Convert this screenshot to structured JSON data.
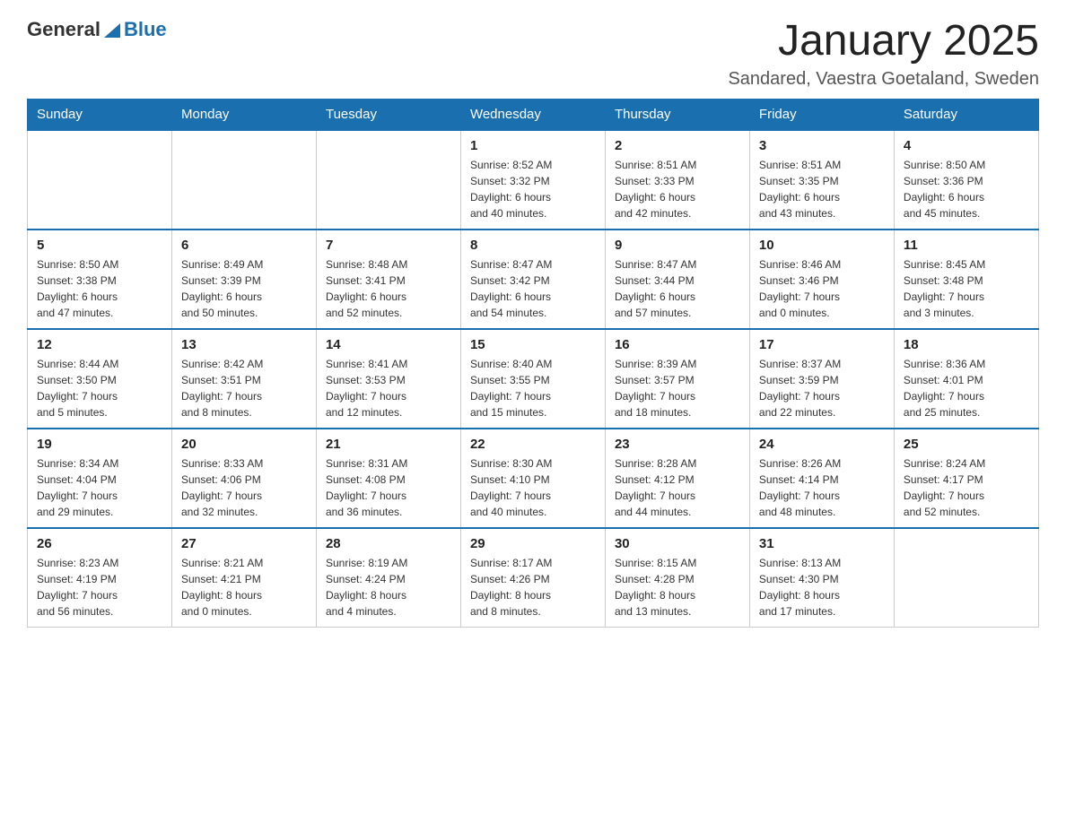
{
  "header": {
    "logo": {
      "general": "General",
      "blue": "Blue"
    },
    "title": "January 2025",
    "subtitle": "Sandared, Vaestra Goetaland, Sweden"
  },
  "weekdays": [
    "Sunday",
    "Monday",
    "Tuesday",
    "Wednesday",
    "Thursday",
    "Friday",
    "Saturday"
  ],
  "weeks": [
    [
      {
        "day": "",
        "info": ""
      },
      {
        "day": "",
        "info": ""
      },
      {
        "day": "",
        "info": ""
      },
      {
        "day": "1",
        "info": "Sunrise: 8:52 AM\nSunset: 3:32 PM\nDaylight: 6 hours\nand 40 minutes."
      },
      {
        "day": "2",
        "info": "Sunrise: 8:51 AM\nSunset: 3:33 PM\nDaylight: 6 hours\nand 42 minutes."
      },
      {
        "day": "3",
        "info": "Sunrise: 8:51 AM\nSunset: 3:35 PM\nDaylight: 6 hours\nand 43 minutes."
      },
      {
        "day": "4",
        "info": "Sunrise: 8:50 AM\nSunset: 3:36 PM\nDaylight: 6 hours\nand 45 minutes."
      }
    ],
    [
      {
        "day": "5",
        "info": "Sunrise: 8:50 AM\nSunset: 3:38 PM\nDaylight: 6 hours\nand 47 minutes."
      },
      {
        "day": "6",
        "info": "Sunrise: 8:49 AM\nSunset: 3:39 PM\nDaylight: 6 hours\nand 50 minutes."
      },
      {
        "day": "7",
        "info": "Sunrise: 8:48 AM\nSunset: 3:41 PM\nDaylight: 6 hours\nand 52 minutes."
      },
      {
        "day": "8",
        "info": "Sunrise: 8:47 AM\nSunset: 3:42 PM\nDaylight: 6 hours\nand 54 minutes."
      },
      {
        "day": "9",
        "info": "Sunrise: 8:47 AM\nSunset: 3:44 PM\nDaylight: 6 hours\nand 57 minutes."
      },
      {
        "day": "10",
        "info": "Sunrise: 8:46 AM\nSunset: 3:46 PM\nDaylight: 7 hours\nand 0 minutes."
      },
      {
        "day": "11",
        "info": "Sunrise: 8:45 AM\nSunset: 3:48 PM\nDaylight: 7 hours\nand 3 minutes."
      }
    ],
    [
      {
        "day": "12",
        "info": "Sunrise: 8:44 AM\nSunset: 3:50 PM\nDaylight: 7 hours\nand 5 minutes."
      },
      {
        "day": "13",
        "info": "Sunrise: 8:42 AM\nSunset: 3:51 PM\nDaylight: 7 hours\nand 8 minutes."
      },
      {
        "day": "14",
        "info": "Sunrise: 8:41 AM\nSunset: 3:53 PM\nDaylight: 7 hours\nand 12 minutes."
      },
      {
        "day": "15",
        "info": "Sunrise: 8:40 AM\nSunset: 3:55 PM\nDaylight: 7 hours\nand 15 minutes."
      },
      {
        "day": "16",
        "info": "Sunrise: 8:39 AM\nSunset: 3:57 PM\nDaylight: 7 hours\nand 18 minutes."
      },
      {
        "day": "17",
        "info": "Sunrise: 8:37 AM\nSunset: 3:59 PM\nDaylight: 7 hours\nand 22 minutes."
      },
      {
        "day": "18",
        "info": "Sunrise: 8:36 AM\nSunset: 4:01 PM\nDaylight: 7 hours\nand 25 minutes."
      }
    ],
    [
      {
        "day": "19",
        "info": "Sunrise: 8:34 AM\nSunset: 4:04 PM\nDaylight: 7 hours\nand 29 minutes."
      },
      {
        "day": "20",
        "info": "Sunrise: 8:33 AM\nSunset: 4:06 PM\nDaylight: 7 hours\nand 32 minutes."
      },
      {
        "day": "21",
        "info": "Sunrise: 8:31 AM\nSunset: 4:08 PM\nDaylight: 7 hours\nand 36 minutes."
      },
      {
        "day": "22",
        "info": "Sunrise: 8:30 AM\nSunset: 4:10 PM\nDaylight: 7 hours\nand 40 minutes."
      },
      {
        "day": "23",
        "info": "Sunrise: 8:28 AM\nSunset: 4:12 PM\nDaylight: 7 hours\nand 44 minutes."
      },
      {
        "day": "24",
        "info": "Sunrise: 8:26 AM\nSunset: 4:14 PM\nDaylight: 7 hours\nand 48 minutes."
      },
      {
        "day": "25",
        "info": "Sunrise: 8:24 AM\nSunset: 4:17 PM\nDaylight: 7 hours\nand 52 minutes."
      }
    ],
    [
      {
        "day": "26",
        "info": "Sunrise: 8:23 AM\nSunset: 4:19 PM\nDaylight: 7 hours\nand 56 minutes."
      },
      {
        "day": "27",
        "info": "Sunrise: 8:21 AM\nSunset: 4:21 PM\nDaylight: 8 hours\nand 0 minutes."
      },
      {
        "day": "28",
        "info": "Sunrise: 8:19 AM\nSunset: 4:24 PM\nDaylight: 8 hours\nand 4 minutes."
      },
      {
        "day": "29",
        "info": "Sunrise: 8:17 AM\nSunset: 4:26 PM\nDaylight: 8 hours\nand 8 minutes."
      },
      {
        "day": "30",
        "info": "Sunrise: 8:15 AM\nSunset: 4:28 PM\nDaylight: 8 hours\nand 13 minutes."
      },
      {
        "day": "31",
        "info": "Sunrise: 8:13 AM\nSunset: 4:30 PM\nDaylight: 8 hours\nand 17 minutes."
      },
      {
        "day": "",
        "info": ""
      }
    ]
  ]
}
